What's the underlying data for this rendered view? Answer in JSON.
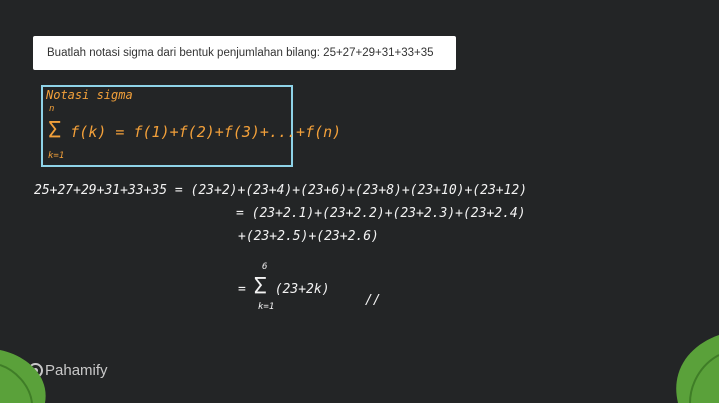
{
  "question": "Buatlah notasi sigma dari bentuk penjumlahan bilang: 25+27+29+31+33+35",
  "definition": {
    "title": "Notasi sigma",
    "formula_sigma": "Σ",
    "formula_body": "f(k) = f(1)+f(2)+f(3)+...+f(n)",
    "upper": "n",
    "lower": "k=1"
  },
  "work": {
    "line1": "25+27+29+31+33+35 = (23+2)+(23+4)+(23+6)+(23+8)+(23+10)+(23+12)",
    "line2": "= (23+2.1)+(23+2.2)+(23+2.3)+(23+2.4)",
    "line3": "+(23+2.5)+(23+2.6)",
    "result_upper": "6",
    "result_prefix": "=",
    "result_sigma": "Σ",
    "result_body": "(23+2k)",
    "result_lower": "k=1",
    "check_mark": "//"
  },
  "brand": {
    "name": "Pahamify"
  },
  "colors": {
    "background": "#232526",
    "ink_orange": "#f2a03a",
    "ink_white": "#f3f3f3",
    "box_cyan": "#8fd3e8",
    "leaf_green": "#5aa13a"
  }
}
